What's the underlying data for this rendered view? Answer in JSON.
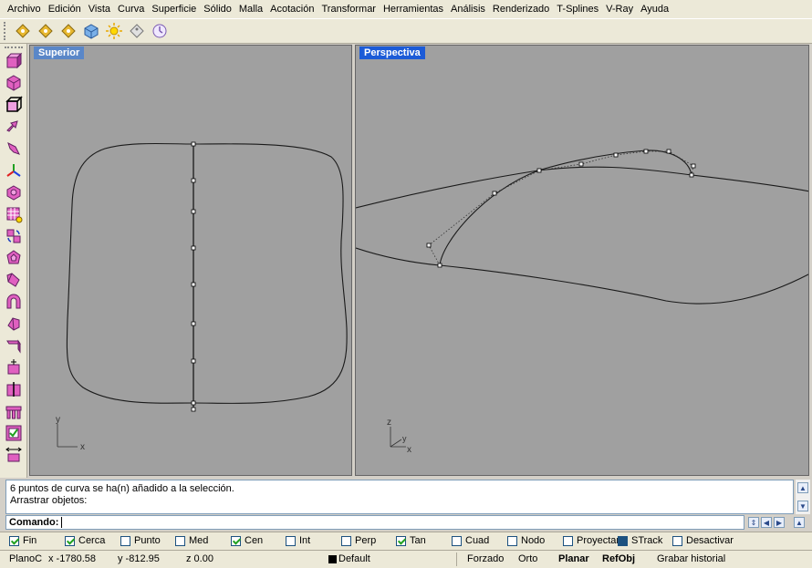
{
  "menu": [
    "Archivo",
    "Edición",
    "Vista",
    "Curva",
    "Superficie",
    "Sólido",
    "Malla",
    "Acotación",
    "Transformar",
    "Herramientas",
    "Análisis",
    "Renderizado",
    "T-Splines",
    "V-Ray",
    "Ayuda"
  ],
  "toolbar_icons": [
    "snap-tag-icon",
    "snap-tag-icon",
    "snap-tag-icon",
    "render-cube-icon",
    "light-burst-icon",
    "tag-icon",
    "clock-icon"
  ],
  "viewports": {
    "top": {
      "title": "Superior",
      "axis_x": "x",
      "axis_y": "y"
    },
    "perspective": {
      "title": "Perspectiva",
      "axis_x": "x",
      "axis_y": "y",
      "axis_z": "z"
    }
  },
  "command_history": [
    "6 puntos de curva se ha(n) añadido a la selección.",
    "Arrastrar objetos:"
  ],
  "command": {
    "label": "Comando:",
    "value": ""
  },
  "osnaps": [
    {
      "label": "Fin",
      "checked": true
    },
    {
      "label": "Cerca",
      "checked": true
    },
    {
      "label": "Punto",
      "checked": false
    },
    {
      "label": "Med",
      "checked": false
    },
    {
      "label": "Cen",
      "checked": true
    },
    {
      "label": "Int",
      "checked": false
    },
    {
      "label": "Perp",
      "checked": false
    },
    {
      "label": "Tan",
      "checked": true
    },
    {
      "label": "Cuad",
      "checked": false
    },
    {
      "label": "Nodo",
      "checked": false
    },
    {
      "label": "Proyectar",
      "checked": false
    },
    {
      "label": "STrack",
      "checked": true
    },
    {
      "label": "Desactivar",
      "checked": false
    }
  ],
  "status": {
    "plane": "PlanoC",
    "x": "x -1780.58",
    "y": "y -812.95",
    "z": "z 0.00",
    "layer": "Default",
    "forzado": "Forzado",
    "orto": "Orto",
    "planar": "Planar",
    "refobj": "RefObj",
    "history": "Grabar historial"
  },
  "colors": {
    "viewport_bg": "#a0a0a0",
    "active_title": "#1c5bd7",
    "layer_swatch": "#000000"
  }
}
